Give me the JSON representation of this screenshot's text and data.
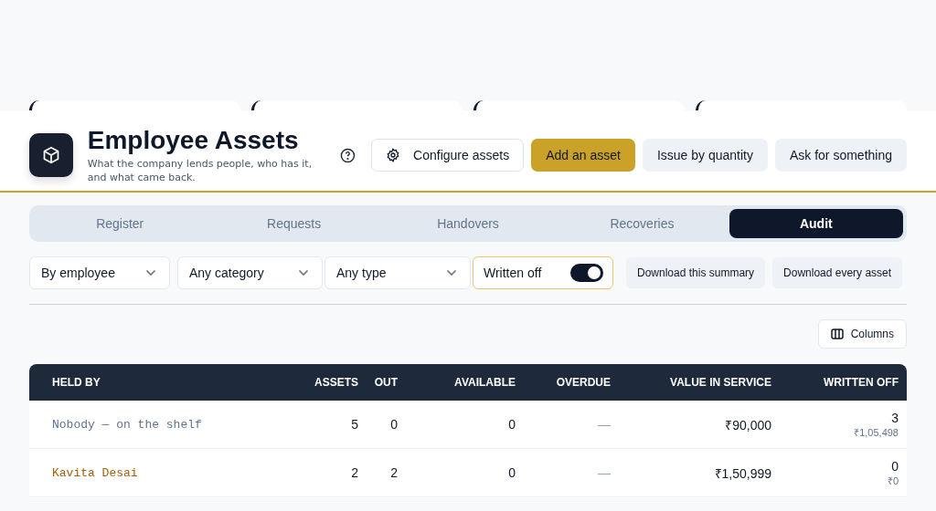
{
  "header": {
    "title": "Employee Assets",
    "subtitle": "What the company lends people, who has it, and what came back.",
    "actions": [
      {
        "label": "Configure assets",
        "kind": "outline"
      },
      {
        "label": "Add an asset",
        "kind": "primary"
      },
      {
        "label": "Issue by quantity",
        "kind": "soft"
      },
      {
        "label": "Ask for something",
        "kind": "soft"
      }
    ]
  },
  "tabs": [
    {
      "label": "Register",
      "selected": false
    },
    {
      "label": "Requests",
      "selected": false
    },
    {
      "label": "Handovers",
      "selected": false
    },
    {
      "label": "Recoveries",
      "selected": false
    },
    {
      "label": "Audit",
      "selected": true
    }
  ],
  "filters": [
    {
      "kind": "select",
      "value": "By employee"
    },
    {
      "kind": "select",
      "value": "Any category"
    },
    {
      "kind": "select",
      "value": "Any type"
    },
    {
      "kind": "toggle",
      "label": "Written off",
      "on": true
    }
  ],
  "downloads": [
    "Download this summary",
    "Download every asset"
  ],
  "columns_button": "Columns",
  "table": {
    "columns": [
      "HELD BY",
      "ASSETS",
      "OUT",
      "AVAILABLE",
      "OVERDUE",
      "VALUE IN SERVICE",
      "WRITTEN OFF"
    ],
    "rows": [
      {
        "held_by": "Nobody — on the shelf",
        "kind": "shelf",
        "assets": "5",
        "out": "0",
        "available": "0",
        "overdue": "—",
        "value": "₹90,000",
        "written_off": "3",
        "written_off_value": "₹1,05,498"
      },
      {
        "held_by": "Kavita Desai",
        "kind": "person",
        "assets": "2",
        "out": "2",
        "available": "0",
        "overdue": "—",
        "value": "₹1,50,999",
        "written_off": "0",
        "written_off_value": "₹0"
      }
    ]
  }
}
